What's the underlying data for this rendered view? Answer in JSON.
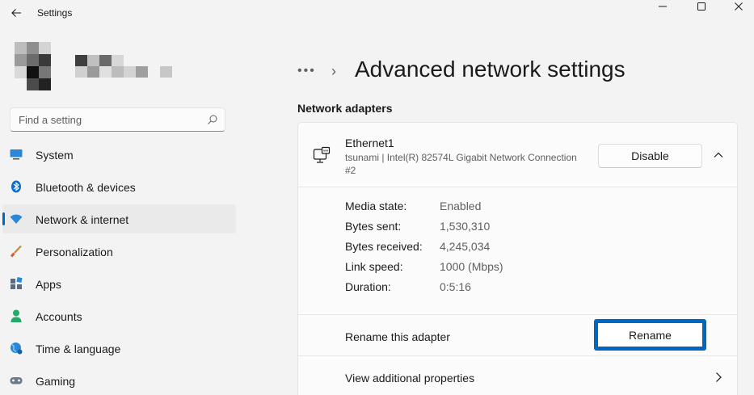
{
  "window": {
    "title": "Settings"
  },
  "search": {
    "placeholder": "Find a setting"
  },
  "sidebar": {
    "items": [
      {
        "label": "System",
        "icon": "system-icon"
      },
      {
        "label": "Bluetooth & devices",
        "icon": "bluetooth-icon"
      },
      {
        "label": "Network & internet",
        "icon": "wifi-icon",
        "active": true
      },
      {
        "label": "Personalization",
        "icon": "brush-icon"
      },
      {
        "label": "Apps",
        "icon": "apps-icon"
      },
      {
        "label": "Accounts",
        "icon": "accounts-icon"
      },
      {
        "label": "Time & language",
        "icon": "globe-icon"
      },
      {
        "label": "Gaming",
        "icon": "gaming-icon"
      }
    ]
  },
  "main": {
    "breadcrumb_more": "•••",
    "breadcrumb_chevron": "›",
    "page_title": "Advanced network settings",
    "section_title": "Network adapters",
    "adapter": {
      "name": "Ethernet1",
      "description": "tsunami | Intel(R) 82574L Gigabit Network Connection #2",
      "disable_label": "Disable",
      "properties": [
        {
          "key": "Media state:",
          "value": "Enabled"
        },
        {
          "key": "Bytes sent:",
          "value": "1,530,310"
        },
        {
          "key": "Bytes received:",
          "value": "4,245,034"
        },
        {
          "key": "Link speed:",
          "value": "1000 (Mbps)"
        },
        {
          "key": "Duration:",
          "value": "0:5:16"
        }
      ],
      "rename_label": "Rename this adapter",
      "rename_button": "Rename",
      "view_properties_label": "View additional properties"
    }
  },
  "colors": {
    "accent": "#0067c0",
    "background": "#f3f3f3",
    "card": "#fbfbfb"
  }
}
